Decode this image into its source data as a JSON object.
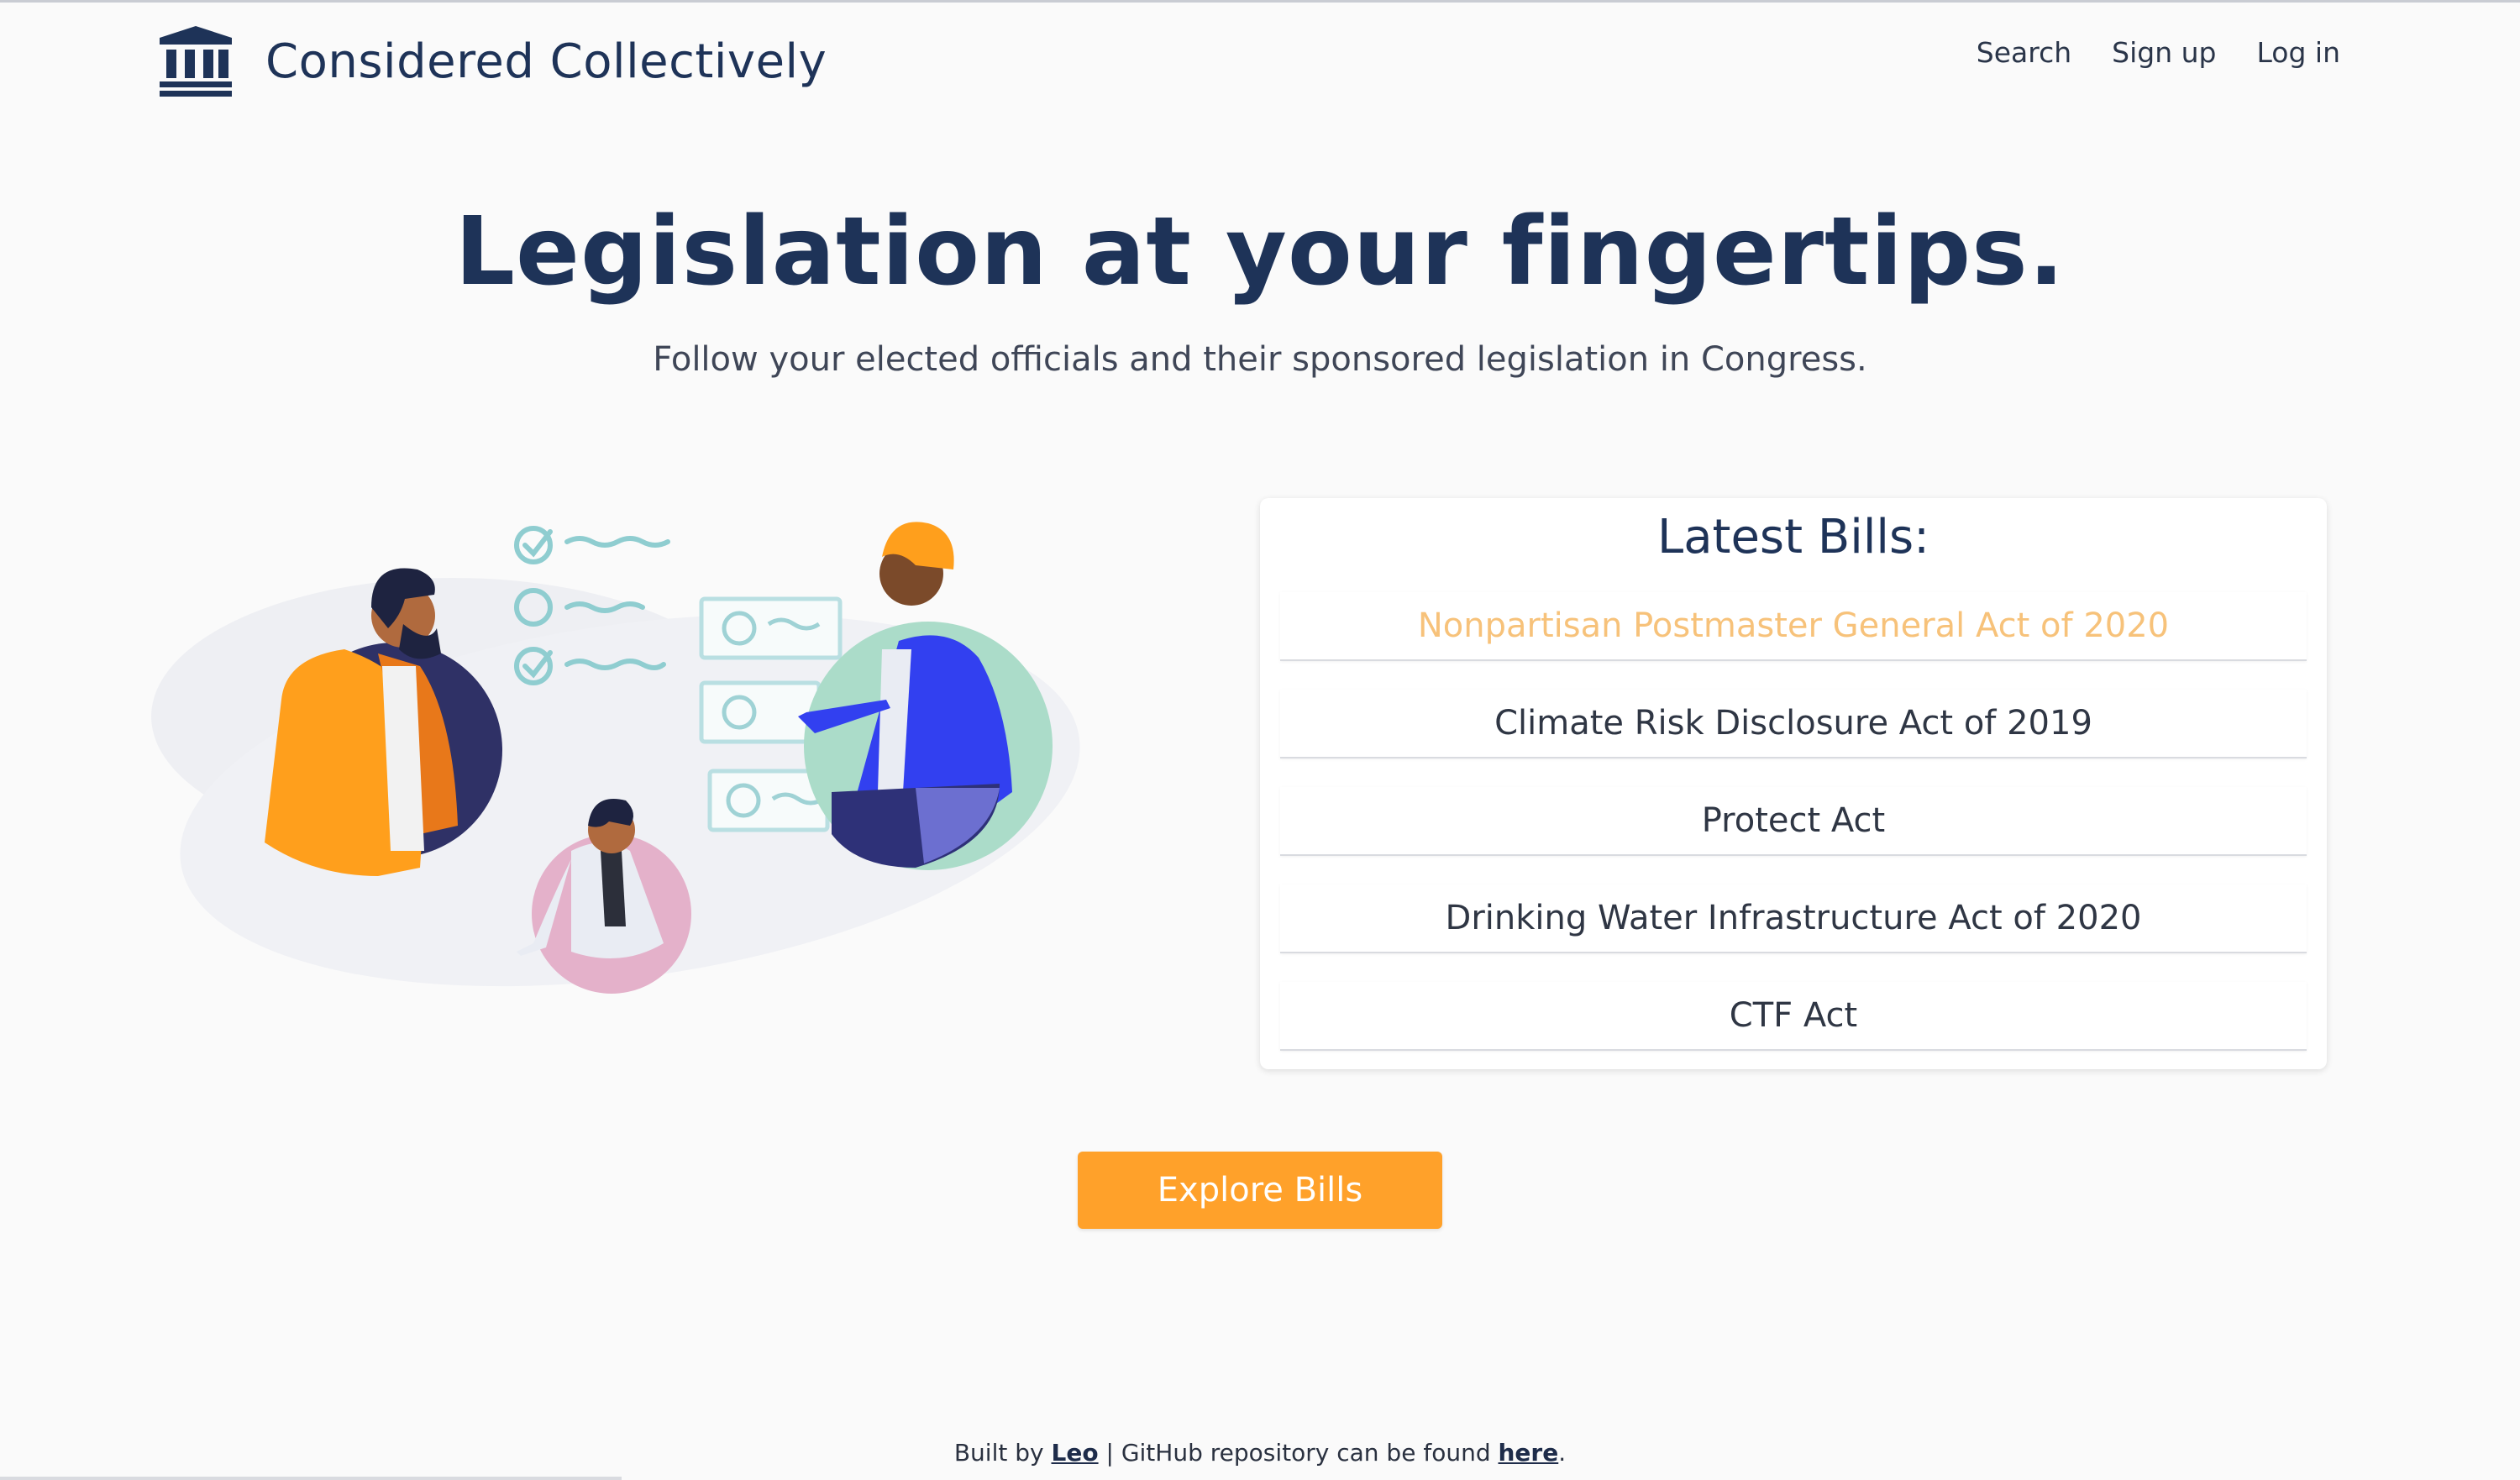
{
  "header": {
    "brand": "Considered Collectively",
    "nav": {
      "search": "Search",
      "signup": "Sign up",
      "login": "Log in"
    }
  },
  "hero": {
    "title": "Legislation at your fingertips.",
    "subtitle": "Follow your elected officials and their sponsored legislation in Congress."
  },
  "bills": {
    "title": "Latest Bills:",
    "items": [
      "Nonpartisan Postmaster General Act of 2020",
      "Climate Risk Disclosure Act of 2019",
      "Protect Act",
      "Drinking Water Infrastructure Act of 2020",
      "CTF Act"
    ]
  },
  "cta": {
    "label": "Explore Bills"
  },
  "footer": {
    "prefix": "Built by",
    "author": "Leo",
    "middle": "| GitHub repository can be found",
    "link": "here",
    "suffix": "."
  },
  "colors": {
    "navy": "#1e3358",
    "accent": "#ffa12a",
    "hover_link": "#f7c27a",
    "background": "#fafafa"
  },
  "icons": {
    "logo": "institution-building-icon"
  }
}
